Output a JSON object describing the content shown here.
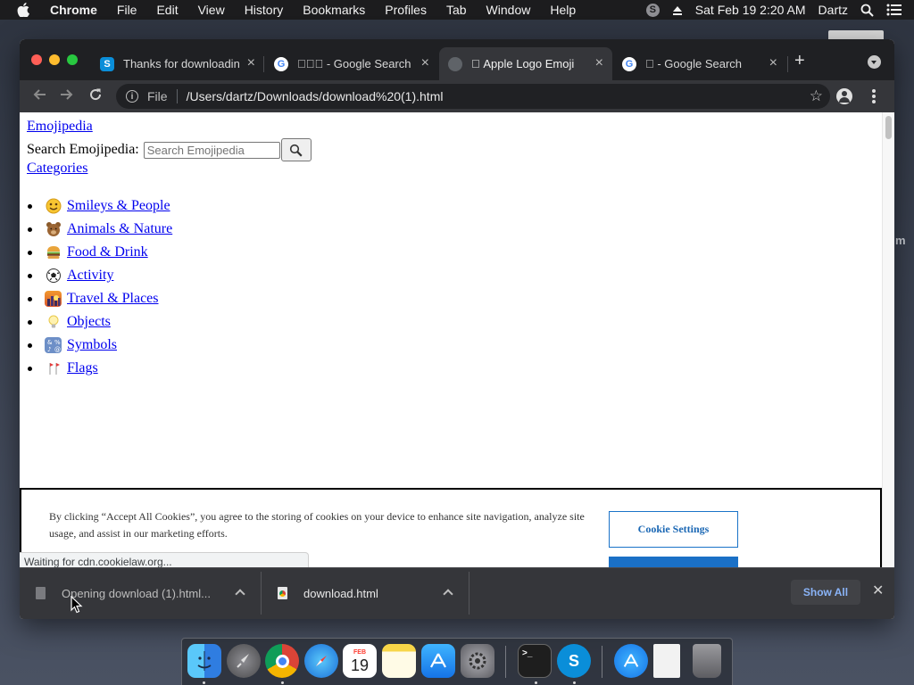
{
  "menubar": {
    "app_name": "Chrome",
    "items": [
      "File",
      "Edit",
      "View",
      "History",
      "Bookmarks",
      "Profiles",
      "Tab",
      "Window",
      "Help"
    ],
    "clock": "Sat Feb 19  2:20 AM",
    "user": "Dartz"
  },
  "tabs": [
    {
      "title": "Thanks for downloadin",
      "favicon": "skype-icon"
    },
    {
      "title": " - Google Search",
      "favicon": "google-icon"
    },
    {
      "title": " Apple Logo Emoji",
      "favicon": "globe-icon"
    },
    {
      "title": " - Google Search",
      "favicon": "google-icon"
    }
  ],
  "address_bar": {
    "scheme_label": "File",
    "url": "/Users/dartz/Downloads/download%20(1).html"
  },
  "page": {
    "site_link": "Emojipedia",
    "search_label": "Search Emojipedia:",
    "search_placeholder": "Search Emojipedia",
    "categories_link": "Categories",
    "categories": [
      {
        "label": "Smileys & People",
        "icon": "smiley-emoji"
      },
      {
        "label": "Animals & Nature",
        "icon": "bear-emoji"
      },
      {
        "label": "Food & Drink",
        "icon": "burger-emoji"
      },
      {
        "label": "Activity",
        "icon": "soccer-ball-emoji"
      },
      {
        "label": "Travel & Places",
        "icon": "sunset-city-emoji"
      },
      {
        "label": "Objects",
        "icon": "light-bulb-emoji"
      },
      {
        "label": "Symbols",
        "icon": "symbols-emoji"
      },
      {
        "label": "Flags",
        "icon": "flags-emoji"
      }
    ]
  },
  "cookie_banner": {
    "text": "By clicking “Accept All Cookies”, you agree to the storing of cookies on your device to enhance site navigation, analyze site usage, and assist in our marketing efforts.",
    "settings_button": "Cookie Settings"
  },
  "status_text": "Waiting for cdn.cookielaw.org...",
  "downloads": {
    "items": [
      {
        "name": "Opening download (1).html...",
        "state": "opening"
      },
      {
        "name": "download.html",
        "state": "complete"
      }
    ],
    "show_all": "Show All"
  },
  "dock": {
    "apps": [
      "finder",
      "launchpad",
      "chrome",
      "safari",
      "calendar",
      "notes",
      "app-store",
      "system-preferences",
      "terminal",
      "skype",
      "app-store-downloads",
      "html-document",
      "trash"
    ],
    "calendar": {
      "month": "FEB",
      "day": "19"
    }
  },
  "colors": {
    "menubar_bg": "#1c1c1e",
    "tabstrip_bg": "#1f2023",
    "toolbar_bg": "#35363a",
    "link": "#0000ee",
    "cookie_accent": "#1a70c6",
    "show_all_text": "#8ab4f8"
  }
}
